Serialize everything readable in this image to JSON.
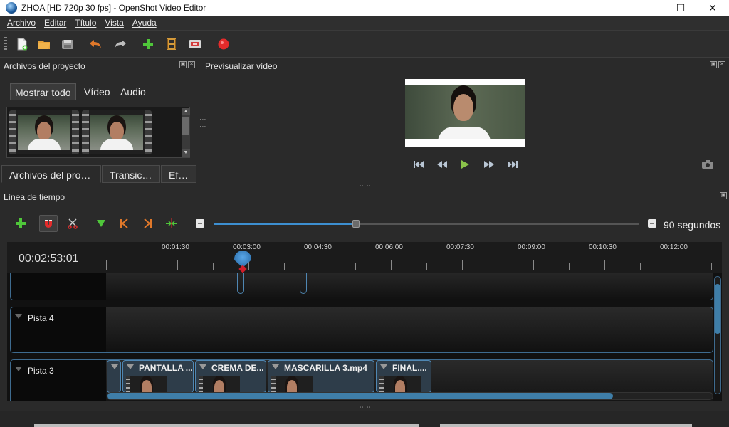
{
  "window": {
    "title": "ZHOA [HD 720p 30 fps] - OpenShot Video Editor",
    "minimize": "—",
    "maximize": "☐",
    "close": "✕"
  },
  "menu": [
    {
      "label": "Archivo"
    },
    {
      "label": "Editar"
    },
    {
      "label": "Título"
    },
    {
      "label": "Vista"
    },
    {
      "label": "Ayuda"
    }
  ],
  "toolbar": {
    "icons": [
      "new-project-icon",
      "open-project-icon",
      "save-project-icon",
      "undo-icon",
      "redo-icon",
      "import-files-icon",
      "profile-icon",
      "fullscreen-icon",
      "record-icon"
    ]
  },
  "project_files": {
    "title": "Archivos del proyecto",
    "filters": [
      "Mostrar todo",
      "Vídeo",
      "Audio"
    ],
    "active_filter": "Mostrar todo",
    "bottom_tabs": [
      "Archivos del pro…",
      "Transic…",
      "Ef…"
    ]
  },
  "preview": {
    "title": "Previsualizar vídeo",
    "controls": [
      "jump-start-icon",
      "rewind-icon",
      "play-icon",
      "fast-forward-icon",
      "jump-end-icon"
    ]
  },
  "timeline": {
    "title": "Línea de tiempo",
    "zoom_label": "90 segundos",
    "zoom_level": 0.33,
    "timecode": "00:02:53:01",
    "ticks": [
      "00:01:30",
      "00:03:00",
      "00:04:30",
      "00:06:00",
      "00:07:30",
      "00:09:00",
      "00:10:30",
      "00:12:00"
    ],
    "tracks": [
      {
        "name": "Pista 4"
      },
      {
        "name": "Pista 3"
      }
    ],
    "clips": [
      {
        "title": "PANTALLA ..."
      },
      {
        "title": "CREMA DE..."
      },
      {
        "title": "MASCARILLA 3.mp4"
      },
      {
        "title": "FINAL...."
      }
    ]
  },
  "colors": {
    "accent": "#3d8fd1",
    "playhead": "#d01d2a",
    "record": "#e52b2b",
    "green": "#4fc63a",
    "orange": "#e0782a"
  }
}
